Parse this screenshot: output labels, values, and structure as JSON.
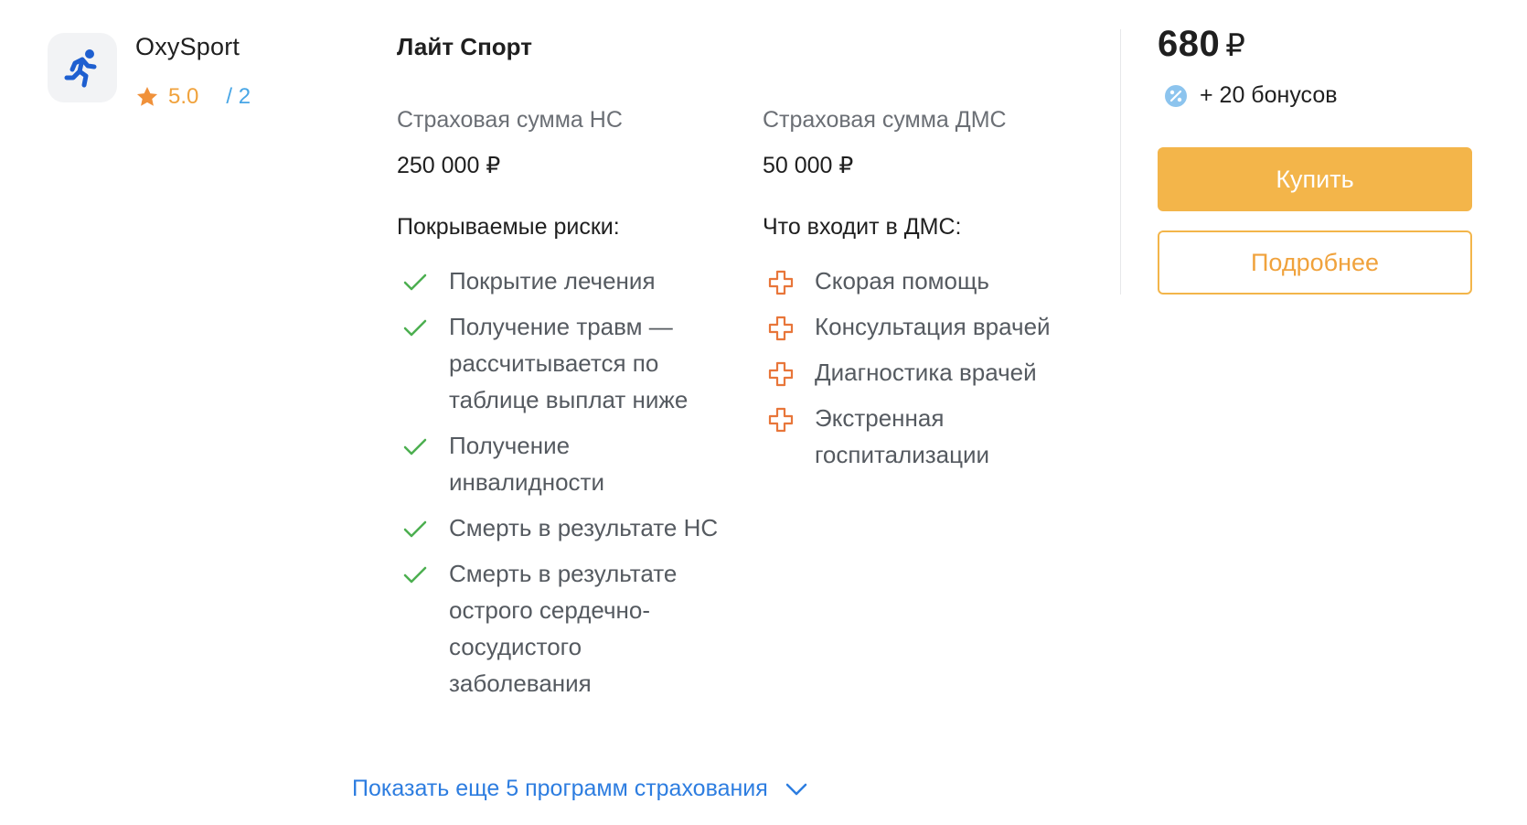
{
  "company": {
    "name": "OxySport",
    "rating": "5.0",
    "reviews": "/ 2",
    "logo_icon": "running-person-icon",
    "accent_color": "#1e5fd0"
  },
  "program": {
    "title": "Лайт Спорт",
    "ns_sum_label": "Страховая сумма НС",
    "ns_sum_value": "250 000 ₽",
    "dms_sum_label": "Страховая сумма ДМС",
    "dms_sum_value": "50 000 ₽",
    "risks_title": "Покрываемые риски:",
    "risks": [
      "Покрытие лечения",
      "Получение травм — рассчитывается по таблице выплат ниже",
      "Получение инвалидности",
      "Смерть в результате НС",
      "Смерть в результате острого сердечно-сосудистого заболевания"
    ],
    "dms_title": "Что входит в ДМС:",
    "dms": [
      "Скорая помощь",
      "Консультация врачей",
      "Диагностика врачей",
      "Экстренная госпитализации"
    ]
  },
  "pricing": {
    "price": "680",
    "currency": "₽",
    "bonus": "+ 20 бонусов",
    "buy_label": "Купить",
    "details_label": "Подробнее",
    "button_color": "#f3b54a"
  },
  "footer": {
    "show_more": "Показать еще 5 программ страхования"
  },
  "colors": {
    "check": "#4caf50",
    "cross": "#e8763a",
    "link": "#2d7de0"
  }
}
